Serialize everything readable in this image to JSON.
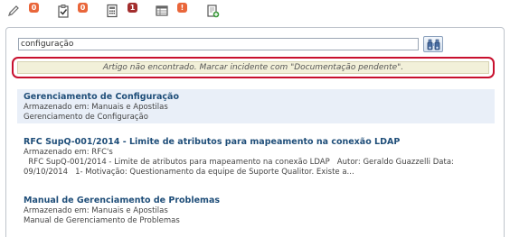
{
  "toolbar": {
    "items": [
      {
        "icon": "pencil-icon",
        "badge": "0",
        "badge_color": "#e9663a"
      },
      {
        "icon": "clipboard-check-icon",
        "badge": "0",
        "badge_color": "#e9663a"
      },
      {
        "icon": "calculator-icon",
        "badge": "1",
        "badge_color": "#a32e2e"
      },
      {
        "icon": "table-icon",
        "badge": "!",
        "badge_color": "#e9663a"
      },
      {
        "icon": "document-add-icon",
        "badge": null,
        "badge_color": null
      }
    ]
  },
  "search": {
    "value": "configuração",
    "button_icon": "binoculars-icon"
  },
  "notice": {
    "text": "Artigo não encontrado. Marcar incidente com \"Documentação pendente\"."
  },
  "results": [
    {
      "title": "Gerenciamento de Configuração",
      "stored_in": "Armazenado em: Manuais e Apostilas",
      "lines": [
        "Gerenciamento de Configuração"
      ]
    },
    {
      "title": "RFC SupQ-001/2014 - Limite de atributos para mapeamento na conexão LDAP",
      "stored_in": "Armazenado em: RFC's",
      "lines": [
        "  RFC SupQ-001/2014 - Limite de atributos para mapeamento na conexão LDAP   Autor: Geraldo Guazzelli Data:",
        "09/10/2014   1- Motivação: Questionamento da equipe de Suporte Qualitor. Existe a..."
      ]
    },
    {
      "title": "Manual de Gerenciamento de Problemas",
      "stored_in": "Armazenado em: Manuais e Apostilas",
      "lines": [
        "Manual de Gerenciamento de Problemas"
      ]
    }
  ]
}
